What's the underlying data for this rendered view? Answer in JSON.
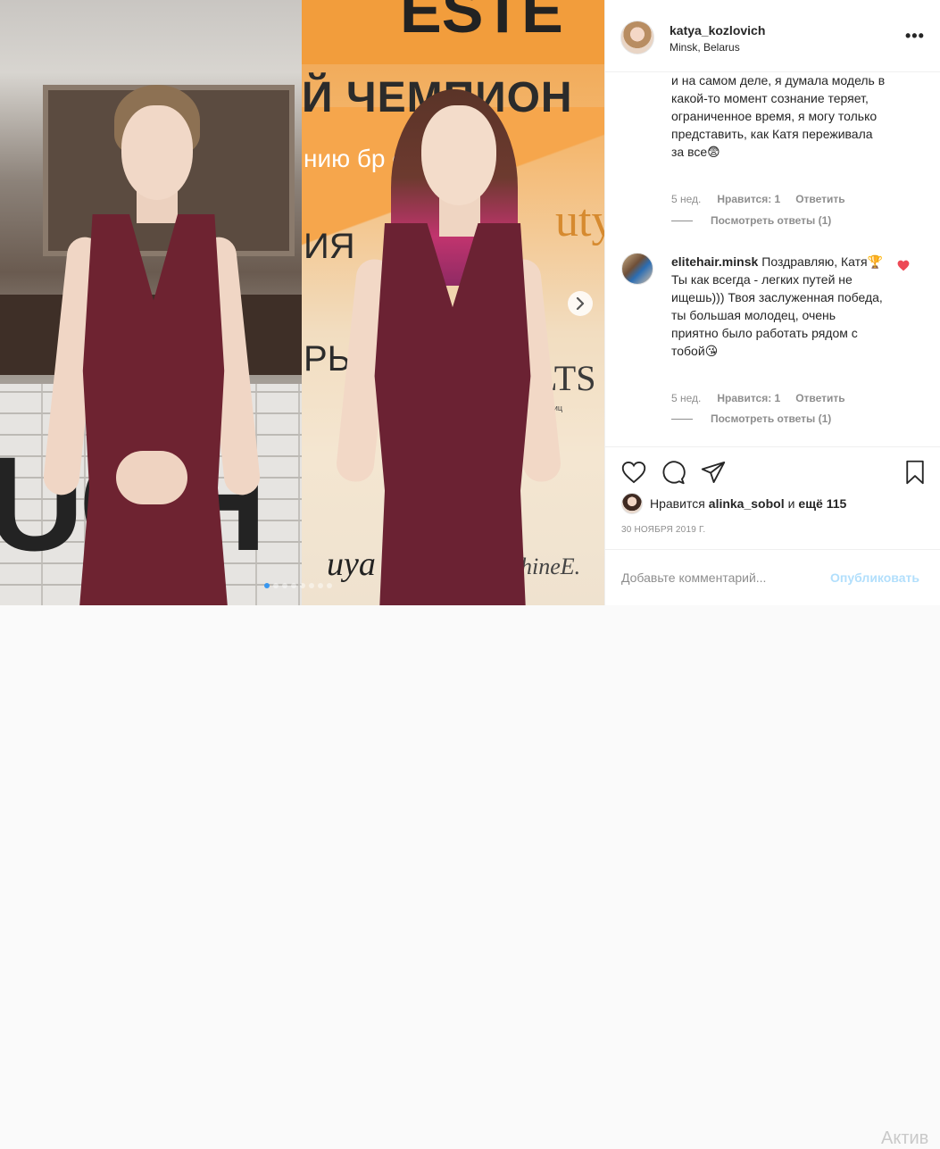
{
  "photo": {
    "left_banner": {
      "letters": "UCH"
    },
    "right_banner": {
      "line1": "Й ЧЕМПИОН",
      "line2": "нию бр    ерманен",
      "line3": "ИЯ",
      "line4": "РЬ",
      "brand1": "uty",
      "brand2": "LTS",
      "brand3": "ShineE.",
      "brand4": "uya",
      "small": "я ресниц",
      "top": "ESTE"
    },
    "carousel": {
      "total": 8,
      "active": 0
    }
  },
  "post": {
    "header": {
      "username": "katya_kozlovich",
      "location": "Minsk, Belarus",
      "more_label": "•••"
    },
    "comments": [
      {
        "text": "и на самом деле, я думала модель в какой-то момент сознание теряет, ограниченное время, я могу только представить, как Катя переживала за все😨",
        "age": "5 нед.",
        "likes": "Нравится: 1",
        "reply": "Ответить",
        "view_replies": "Посмотреть ответы (1)"
      },
      {
        "username": "elitehair.minsk",
        "text": "Поздравляю, Катя🏆 Ты как всегда - легких путей не ищешь))) Твоя заслуженная победа, ты большая молодец, очень приятно было работать рядом с тобой😘",
        "age": "5 нед.",
        "likes": "Нравится: 1",
        "reply": "Ответить",
        "view_replies": "Посмотреть ответы (1)"
      }
    ],
    "likes": {
      "prefix": "Нравится",
      "user": "alinka_sobol",
      "connector": "и",
      "others": "ещё 115"
    },
    "date": "30 НОЯБРЯ 2019 Г.",
    "comment_box": {
      "placeholder": "Добавьте комментарий...",
      "publish": "Опубликовать"
    },
    "watermark": "Актив"
  },
  "colors": {
    "heart_liked": "#ed4956",
    "link_blue": "#3897f0",
    "publish_disabled": "#b2dffc",
    "muted_text": "#8e8e8e"
  }
}
